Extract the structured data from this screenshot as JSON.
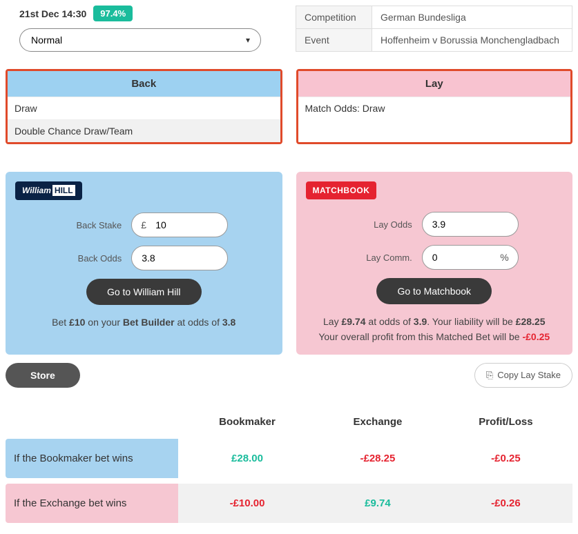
{
  "header": {
    "datetime": "21st Dec 14:30",
    "percentage": "97.4%",
    "mode_selected": "Normal"
  },
  "info": {
    "competition_label": "Competition",
    "competition_value": "German Bundesliga",
    "event_label": "Event",
    "event_value": "Hoffenheim v Borussia Monchengladbach"
  },
  "back_box": {
    "header": "Back",
    "items": [
      "Draw",
      "Double Chance Draw/Team"
    ]
  },
  "lay_box": {
    "header": "Lay",
    "items": [
      "Match Odds: Draw"
    ]
  },
  "back_card": {
    "brand_part1": "William",
    "brand_part2": "HILL",
    "stake_label": "Back Stake",
    "stake_currency": "£",
    "stake_value": "10",
    "odds_label": "Back Odds",
    "odds_value": "3.8",
    "go_button": "Go to William Hill",
    "summary_pre": "Bet ",
    "summary_amt": "£10",
    "summary_mid": " on your ",
    "summary_bb": "Bet Builder",
    "summary_at": " at odds of ",
    "summary_odds": "3.8"
  },
  "lay_card": {
    "brand": "MATCHBOOK",
    "odds_label": "Lay Odds",
    "odds_value": "3.9",
    "comm_label": "Lay Comm.",
    "comm_value": "0",
    "comm_suffix": "%",
    "go_button": "Go to Matchbook",
    "line1_pre": "Lay ",
    "line1_amt": "£9.74",
    "line1_mid": " at odds of ",
    "line1_odds": "3.9",
    "line1_post": ". Your liability will be ",
    "line1_liab": "£28.25",
    "line2_pre": "Your overall profit from this Matched Bet will be ",
    "line2_profit": "-£0.25"
  },
  "actions": {
    "store": "Store",
    "copy": "Copy Lay Stake"
  },
  "results": {
    "col_bookmaker": "Bookmaker",
    "col_exchange": "Exchange",
    "col_pl": "Profit/Loss",
    "row_bm_label": "If the Bookmaker bet wins",
    "row_bm_bookmaker": "£28.00",
    "row_bm_exchange": "-£28.25",
    "row_bm_pl": "-£0.25",
    "row_ex_label": "If the Exchange bet wins",
    "row_ex_bookmaker": "-£10.00",
    "row_ex_exchange": "£9.74",
    "row_ex_pl": "-£0.26"
  }
}
